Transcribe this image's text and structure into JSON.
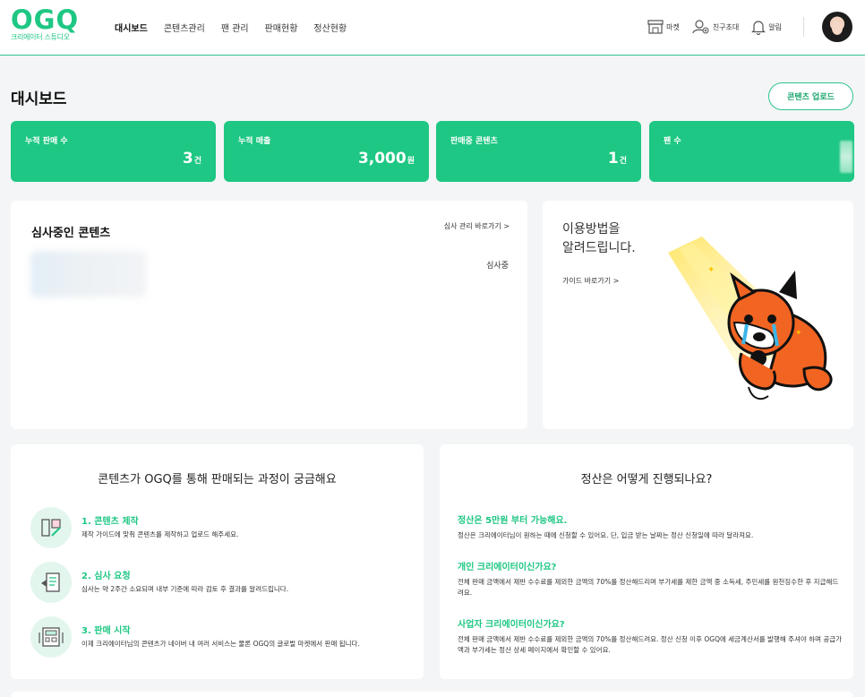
{
  "header": {
    "logo": "OGQ",
    "logo_sub": "크리에이터 스튜디오",
    "nav": [
      "대시보드",
      "콘텐츠관리",
      "팬 관리",
      "판매현황",
      "정산현황"
    ],
    "market_label": "마켓",
    "invite_label": "친구초대",
    "alarm_label": "알림"
  },
  "page": {
    "title": "대시보드",
    "upload_button": "콘텐츠 업로드"
  },
  "stats": [
    {
      "label": "누적 판매 수",
      "value": "3",
      "unit": "건"
    },
    {
      "label": "누적 매출",
      "value": "3,000",
      "unit": "원"
    },
    {
      "label": "판매중 콘텐츠",
      "value": "1",
      "unit": "건"
    },
    {
      "label": "팬 수",
      "value": "",
      "unit": ""
    }
  ],
  "review": {
    "title": "심사중인 콘텐츠",
    "link": "심사 관리 바로가기 >",
    "status": "심사중"
  },
  "guide": {
    "title": "이용방법을\n알려드립니다.",
    "link": "가이드 바로가기 >"
  },
  "process": {
    "title": "콘텐츠가 OGQ를 통해 판매되는 과정이 궁금해요",
    "steps": [
      {
        "head": "1. 콘텐츠 제작",
        "desc": "제작 가이드에 맞춰 콘텐츠를 제작하고 업로드 해주세요."
      },
      {
        "head": "2. 심사 요청",
        "desc": "심사는 약 2주간 소요되며 내부 기준에 따라 검토 후 결과를 알려드립니다."
      },
      {
        "head": "3. 판매 시작",
        "desc": "이제 크리에이터님의 콘텐츠가 네이버 내 여러 서비스는 물론 OGQ의 글로벌 마켓에서 판매 됩니다."
      }
    ]
  },
  "settlement": {
    "title": "정산은 어떻게 진행되나요?",
    "faqs": [
      {
        "q": "정산은 5만원 부터 가능해요.",
        "a": "정산은 크리에이터님이 원하는 때에 신청할 수 있어요. 단, 입금 받는 날짜는 정산 신청일에 따라 달라져요."
      },
      {
        "q": "개인 크리에이터이신가요?",
        "a": "전체 판매 금액에서 제반 수수료를 제외한 금액의 70%를 정산해드리며 부가세를 제한 금액 중 소득세, 주민세를 원천징수한 후 지급해드려요."
      },
      {
        "q": "사업자 크리에이터이신가요?",
        "a": "전체 판매 금액에서 제반 수수료를 제외한 금액의 70%를 정산해드려요. 정산 신청 이후 OGQ에 세금계산서를 발행해 주셔야 하며 공급가액과 부가세는 정산 상세 페이지에서 확인할 수 있어요."
      }
    ]
  }
}
